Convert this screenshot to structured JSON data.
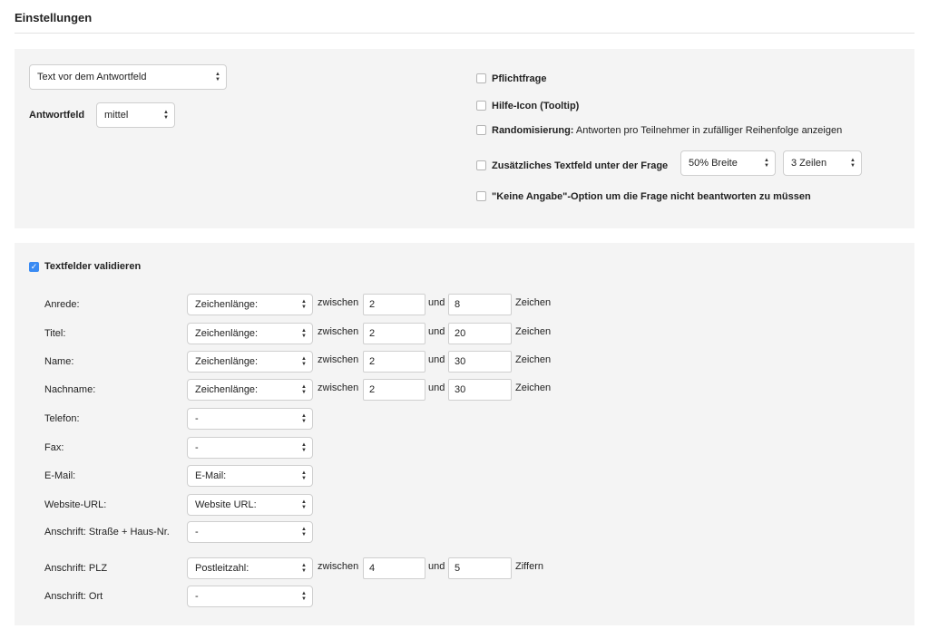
{
  "page_title": "Einstellungen",
  "settings": {
    "text_position_select": "Text vor dem Antwortfeld",
    "answer_field_label": "Antwortfeld",
    "answer_field_select": "mittel",
    "required": {
      "label": "Pflichtfrage",
      "checked": false
    },
    "help_icon": {
      "label": "Hilfe-Icon (Tooltip)",
      "checked": false
    },
    "randomize": {
      "label_bold": "Randomisierung:",
      "label_rest": "Antworten pro Teilnehmer in zufälliger Reihenfolge anzeigen",
      "checked": false
    },
    "extra_textfield": {
      "label": "Zusätzliches Textfeld unter der Frage",
      "width_select": "50% Breite",
      "rows_select": "3 Zeilen",
      "checked": false
    },
    "no_answer": {
      "label_bold": "\"Keine Angabe\"-Option um die Frage nicht beantworten zu müssen",
      "checked": false
    }
  },
  "validation": {
    "toggle_label": "Textfelder validieren",
    "checked": true,
    "between_label": "zwischen",
    "and_label": "und",
    "rows": [
      {
        "label": "Anrede:",
        "type": "Zeichenlänge:",
        "min": "2",
        "max": "8",
        "unit": "Zeichen"
      },
      {
        "label": "Titel:",
        "type": "Zeichenlänge:",
        "min": "2",
        "max": "20",
        "unit": "Zeichen"
      },
      {
        "label": "Name:",
        "type": "Zeichenlänge:",
        "min": "2",
        "max": "30",
        "unit": "Zeichen"
      },
      {
        "label": "Nachname:",
        "type": "Zeichenlänge:",
        "min": "2",
        "max": "30",
        "unit": "Zeichen"
      },
      {
        "label": "Telefon:",
        "type": "-"
      },
      {
        "label": "Fax:",
        "type": "-"
      },
      {
        "label": "E-Mail:",
        "type": "E-Mail:"
      },
      {
        "label": "Website-URL:",
        "type": "Website URL:"
      },
      {
        "label": "Anschrift: Straße + Haus-Nr.",
        "type": "-"
      },
      {
        "label": "Anschrift: PLZ",
        "type": "Postleitzahl:",
        "min": "4",
        "max": "5",
        "unit": "Ziffern"
      },
      {
        "label": "Anschrift: Ort",
        "type": "-"
      }
    ]
  }
}
